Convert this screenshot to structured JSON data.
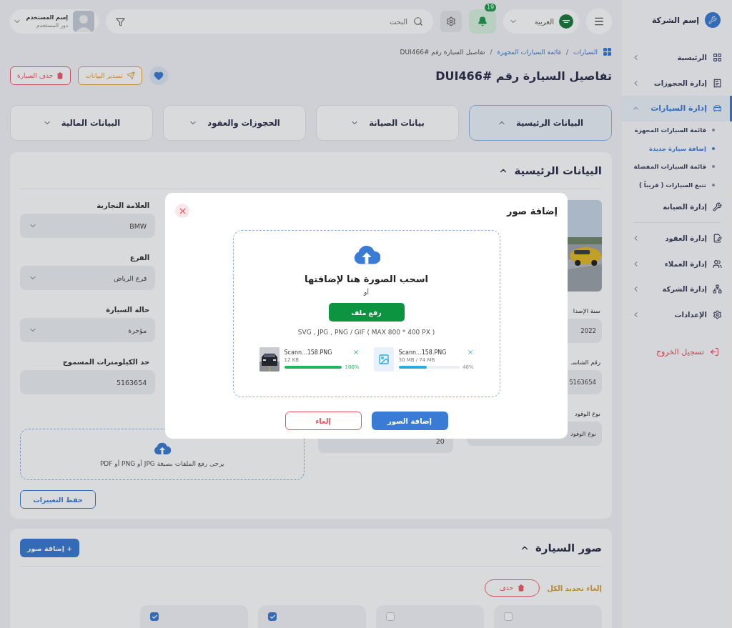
{
  "sidebar": {
    "company": "إسم الشركة",
    "groups": [
      {
        "items": [
          {
            "label": "الرئيسية",
            "kind": "group",
            "expanded": false
          },
          {
            "label": "إدارة الحجوزات",
            "kind": "group",
            "expanded": false
          },
          {
            "label": "إدارة السيارات",
            "kind": "group",
            "expanded": true,
            "children": [
              {
                "label": "قائمة السيارات المجهزة",
                "selected": false
              },
              {
                "label": "إضافة سيارة جديدة",
                "selected": true
              },
              {
                "label": "قائمة السيارات المفضلة",
                "selected": false
              },
              {
                "label": "تتبع السيارات ( قريباً )",
                "selected": false
              }
            ]
          },
          {
            "label": "إدارة الصيانة",
            "kind": "link"
          }
        ]
      },
      {
        "items": [
          {
            "label": "إدارة العقود",
            "kind": "group",
            "expanded": false
          },
          {
            "label": "إدارة العملاء",
            "kind": "group",
            "expanded": false
          },
          {
            "label": "إدارة الشركة",
            "kind": "group",
            "expanded": false
          },
          {
            "label": "الإعدادات",
            "kind": "group",
            "expanded": false
          }
        ]
      }
    ],
    "logout": "تسجيل الخروج"
  },
  "topbar": {
    "language": "العربية",
    "notifications": "19",
    "search": {
      "placeholder": "البحث"
    },
    "user": {
      "name": "إسم المستخدم",
      "role": "دور المستخدم"
    }
  },
  "breadcrumb": {
    "separator": "/",
    "items": [
      "السيارات",
      "قائمة السيارات المجهزة",
      "تفاصيل السيارة رقم #DUI466"
    ]
  },
  "page": {
    "title": "تفاصيل السيارة رقم #DUI466",
    "favorite": true,
    "actions": [
      {
        "label": "تصدير البيانات",
        "kind": "export"
      },
      {
        "label": "حذف السيارة",
        "kind": "delete"
      }
    ]
  },
  "tabs": [
    {
      "label": "البيانات الرئيسية",
      "selected": true
    },
    {
      "label": "بيانات الصيانة",
      "selected": false
    },
    {
      "label": "الحجوزات والعقود",
      "selected": false
    },
    {
      "label": "البيانات المالية",
      "selected": false
    }
  ],
  "main_section": {
    "title": "البيانات الرئيسية",
    "expanded": true,
    "column_1": [
      {
        "kind": "picture"
      },
      {
        "kind": "input",
        "label": "سنة الإصدا",
        "value": "2022"
      },
      {
        "kind": "input",
        "label": "رقم الشاسـ",
        "value": "5163654"
      },
      {
        "kind": "input",
        "label": "نوع الوقود",
        "value": "نوع الوقود"
      }
    ],
    "column_2": [
      {
        "value": "20"
      }
    ],
    "column_3": [
      {
        "kind": "select",
        "label": "العلامة التجارية",
        "value": "BMW"
      },
      {
        "kind": "select",
        "label": "الفرع",
        "value": "فرع الرياض"
      },
      {
        "kind": "select",
        "label": "حالة السيارة",
        "value": "مؤجرة"
      },
      {
        "kind": "input",
        "label": "حد الكيلومترات المسموح",
        "value": "5163654"
      }
    ],
    "upload_hint": "يرجى رفع الملفات بصيغة JPG أو PNG أو PDF",
    "save_button": "حفظ التغييرات"
  },
  "photos_section": {
    "title": "صور السيارة",
    "expanded": true,
    "add_button": "+ إضافة صور",
    "deselect_all": "إلغاء تحديد الكل",
    "delete_button": "حذف",
    "items": [
      {
        "selected": false
      },
      {
        "selected": false
      },
      {
        "selected": true
      },
      {
        "selected": true
      }
    ]
  },
  "modal": {
    "title": "إضافة صور",
    "heading": "اسحب الصورة هنا لإضافتها",
    "or": "أو",
    "upload_button": "رفع ملف",
    "formats": "SVG , JPG , PNG / GIF ( MAX 800 * 400 PX )",
    "files": [
      {
        "kind": "icon",
        "name": "Scann...158.PNG",
        "size": "30 MB / 74 MB",
        "level": 0.46,
        "percent": "46%",
        "color": "#2eaadc"
      },
      {
        "kind": "picture",
        "name": "Scann...158.PNG",
        "size": "12 KB",
        "level": 1,
        "percent": "100%",
        "color": "#22b35e"
      }
    ],
    "buttons": [
      {
        "label": "إضافة الصور",
        "kind": "primary"
      },
      {
        "label": "إلغاء",
        "kind": "cancel"
      }
    ]
  }
}
